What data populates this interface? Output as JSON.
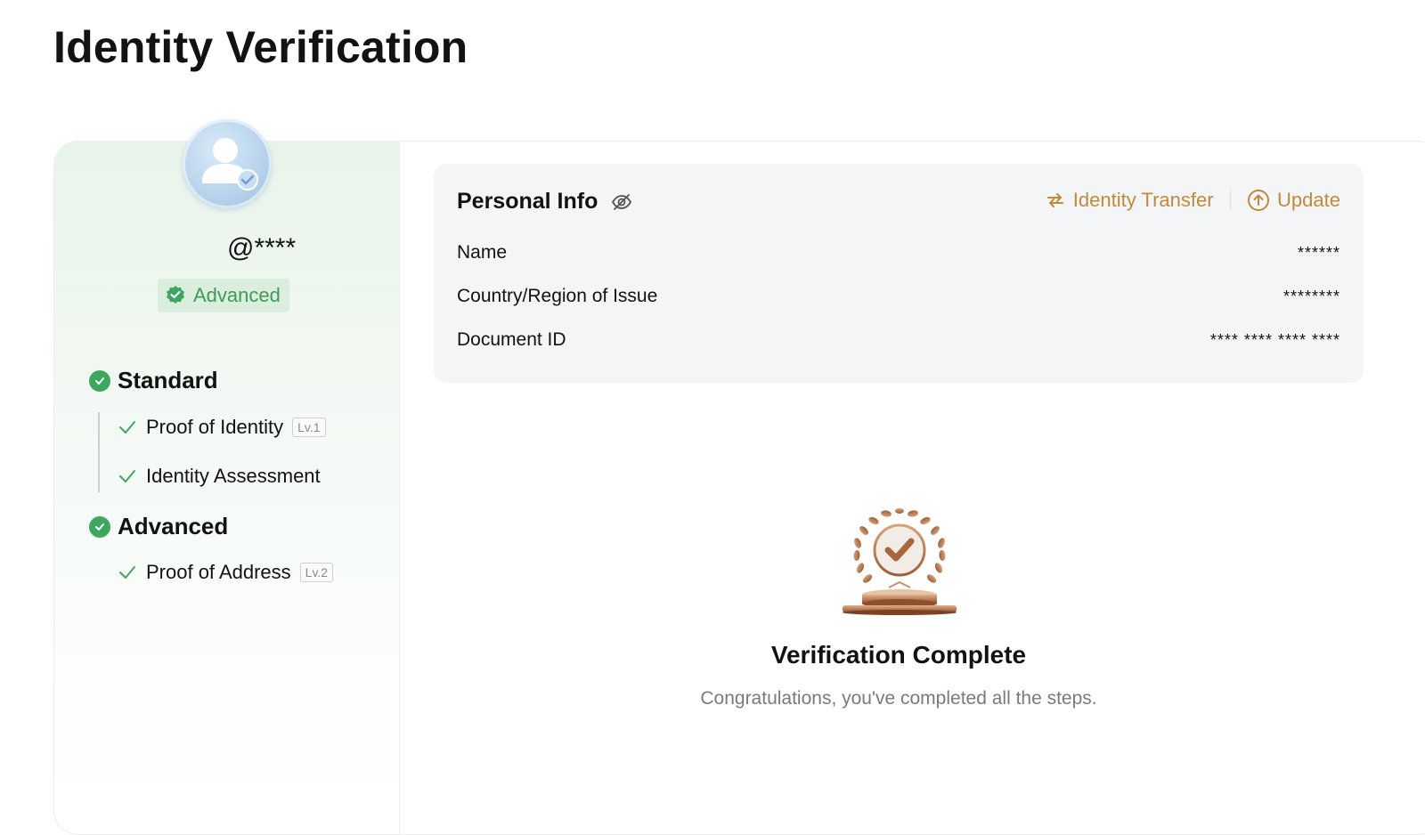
{
  "page": {
    "title": "Identity Verification"
  },
  "profile": {
    "username": "@****",
    "level_badge": "Advanced"
  },
  "progress": {
    "sections": [
      {
        "label": "Standard",
        "steps": [
          {
            "label": "Proof of Identity",
            "tag": "Lv.1"
          },
          {
            "label": "Identity Assessment",
            "tag": ""
          }
        ]
      },
      {
        "label": "Advanced",
        "steps": [
          {
            "label": "Proof of Address",
            "tag": "Lv.2"
          }
        ]
      }
    ]
  },
  "personal_info": {
    "title": "Personal Info",
    "actions": {
      "transfer": "Identity Transfer",
      "update": "Update"
    },
    "rows": [
      {
        "label": "Name",
        "value": "******"
      },
      {
        "label": "Country/Region of Issue",
        "value": "********"
      },
      {
        "label": "Document ID",
        "value": "**** **** **** ****"
      }
    ]
  },
  "complete": {
    "title": "Verification Complete",
    "subtitle": "Congratulations, you've completed all the steps."
  },
  "colors": {
    "accent_green": "#3fa660",
    "accent_gold": "#c08a3e",
    "badge_bg": "#dbeedd",
    "bronze": "#b9774a"
  },
  "icons": {
    "avatar": "verified-user-icon",
    "badge": "verified-seal-icon",
    "hide": "eye-off-icon",
    "transfer": "swap-icon",
    "update": "arrow-up-circle-icon",
    "trophy": "laurel-trophy-icon"
  }
}
